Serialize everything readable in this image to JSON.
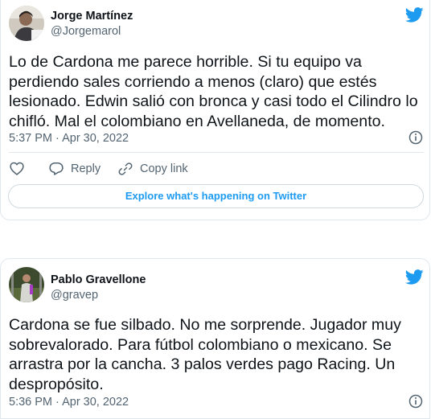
{
  "tweet1": {
    "name": "Jorge Martínez",
    "handle": "@Jorgemarol",
    "text": "Lo de Cardona me parece horrible. Si tu equipo va perdiendo sales corriendo a menos (claro) que estés lesionado. Edwin salió con bronca y casi todo el Cilindro lo chifló. Mal el colombiano en Avellaneda, de momento.",
    "timestamp": "5:37 PM · Apr 30, 2022",
    "reply_label": "Reply",
    "copy_link_label": "Copy link",
    "explore_label": "Explore what's happening on Twitter"
  },
  "tweet2": {
    "name": "Pablo Gravellone",
    "handle": "@gravep",
    "text": "Cardona se fue silbado.  No me sorprende. Jugador muy sobrevalorado.  Para fútbol colombiano o mexicano. Se arrastra por la cancha. 3 palos verdes pago Racing. Un despropósito.",
    "timestamp": "5:36 PM · Apr 30, 2022"
  },
  "colors": {
    "twitter_blue": "#1d9bf0",
    "text_primary": "#0f1419",
    "text_secondary": "#536471",
    "border": "#e1e8ed"
  },
  "icons": [
    "twitter-bird-icon",
    "info-icon",
    "heart-icon",
    "reply-icon",
    "link-icon"
  ]
}
